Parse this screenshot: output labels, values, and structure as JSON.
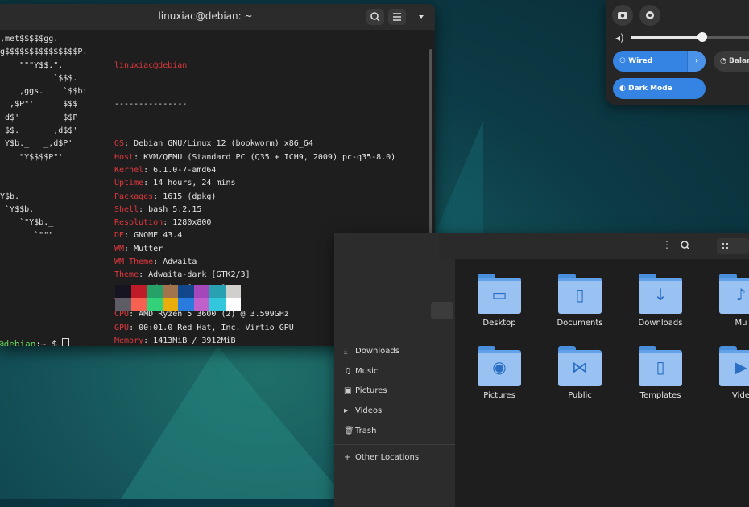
{
  "terminal": {
    "title": "linuxiac@debian: ~",
    "ascii": [
      "_,met$$$$$gg.",
      ",g$$$$$$$$$$$$$$$P.",
      "     \"\"\"Y$$.\".",
      "            `$$$.",
      "     ,ggs.    `$$b:",
      "   ,$P\"'      $$$",
      "  d$'         $$P",
      "  $$.       ,d$$'",
      "  Y$b._   _,d$P'",
      "     \"Y$$$$P\"'",
      "",
      "",
      " Y$b.",
      "  `Y$$b.",
      "     `\"Y$b._",
      "        `\"\"\""
    ],
    "userhost": "linuxiac@debian",
    "separator": "---------------",
    "info": [
      {
        "key": "OS",
        "value": "Debian GNU/Linux 12 (bookworm) x86_64"
      },
      {
        "key": "Host",
        "value": "KVM/QEMU (Standard PC (Q35 + ICH9, 2009) pc-q35-8.0)"
      },
      {
        "key": "Kernel",
        "value": "6.1.0-7-amd64"
      },
      {
        "key": "Uptime",
        "value": "14 hours, 24 mins"
      },
      {
        "key": "Packages",
        "value": "1615 (dpkg)"
      },
      {
        "key": "Shell",
        "value": "bash 5.2.15"
      },
      {
        "key": "Resolution",
        "value": "1280x800"
      },
      {
        "key": "DE",
        "value": "GNOME 43.4"
      },
      {
        "key": "WM",
        "value": "Mutter"
      },
      {
        "key": "WM Theme",
        "value": "Adwaita"
      },
      {
        "key": "Theme",
        "value": "Adwaita-dark [GTK2/3]"
      },
      {
        "key": "Icons",
        "value": "Adwaita [GTK2/3]"
      },
      {
        "key": "Terminal",
        "value": "gnome-terminal"
      },
      {
        "key": "CPU",
        "value": "AMD Ryzen 5 3600 (2) @ 3.599GHz"
      },
      {
        "key": "GPU",
        "value": "00:01.0 Red Hat, Inc. Virtio GPU"
      },
      {
        "key": "Memory",
        "value": "1413MiB / 3912MiB"
      }
    ],
    "palette_row1": [
      "#171421",
      "#c01c28",
      "#26a269",
      "#a2734c",
      "#12488b",
      "#a347ba",
      "#2aa1b3",
      "#d0cfcc"
    ],
    "palette_row2": [
      "#5e5c64",
      "#f66151",
      "#33d17a",
      "#e9ad0c",
      "#2a7bde",
      "#c061cb",
      "#33c7de",
      "#ffffff"
    ],
    "prompt_user": "@debian",
    "prompt_rest": ":~ $ "
  },
  "quick_settings": {
    "volume_level": 0.55,
    "wired_label": "Wired",
    "dark_mode_label": "Dark Mode",
    "balanced_label": "Balan"
  },
  "files": {
    "sidebar": [
      "Downloads",
      "Music",
      "Pictures",
      "Videos",
      "Trash",
      "Other Locations"
    ],
    "folders": [
      {
        "label": "Desktop",
        "icon": "desktop-folder-icon",
        "glyph": "▭"
      },
      {
        "label": "Documents",
        "icon": "documents-folder-icon",
        "glyph": "▯"
      },
      {
        "label": "Downloads",
        "icon": "downloads-folder-icon",
        "glyph": "↓"
      },
      {
        "label": "Mu",
        "icon": "music-folder-icon",
        "glyph": "♪"
      },
      {
        "label": "Pictures",
        "icon": "pictures-folder-icon",
        "glyph": "◉"
      },
      {
        "label": "Public",
        "icon": "public-folder-icon",
        "glyph": "⋈"
      },
      {
        "label": "Templates",
        "icon": "templates-folder-icon",
        "glyph": "▯"
      },
      {
        "label": "Vide",
        "icon": "videos-folder-icon",
        "glyph": "▶"
      }
    ]
  }
}
